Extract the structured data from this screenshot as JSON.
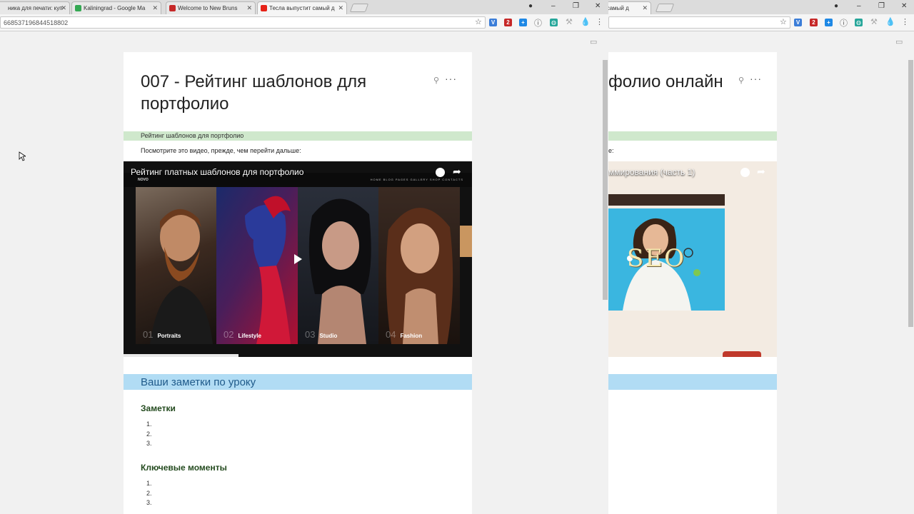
{
  "left": {
    "tabs": [
      {
        "title": "ника для печати: куп",
        "fav": "#e64a19"
      },
      {
        "title": "Kaliningrad - Google Ma",
        "fav": "#34a853"
      },
      {
        "title": "Welcome to New Bruns",
        "fav": "#c62828"
      },
      {
        "title": "Тесла выпустит самый д",
        "fav": "#e62117"
      }
    ],
    "url": "668537196844518802",
    "page_title": "007 - Рейтинг шаблонов для портфолио",
    "green_band": "Рейтинг шаблонов для портфолио",
    "hint": "Посмотрите это видео, прежде, чем перейти дальше:",
    "video": {
      "title": "Рейтинг платных шаблонов для портфолио",
      "nav_logo": "NOVO",
      "nav_links": "HOME  BLOG  PAGES  GALLERY  SHOP  CONTACTS",
      "panels": [
        {
          "num": "01",
          "label": "Portraits"
        },
        {
          "num": "02",
          "label": "Lifestyle"
        },
        {
          "num": "03",
          "label": "Studio"
        },
        {
          "num": "04",
          "label": "Fashion"
        }
      ],
      "progress": 0.33
    },
    "notes_band": "Ваши заметки по уроку",
    "notes_heading": "Заметки",
    "notes_items": [
      "1.",
      "2.",
      "3."
    ],
    "key_heading": "Ключевые моменты",
    "key_items": [
      "1.",
      "2.",
      "3."
    ]
  },
  "right": {
    "tabs": [
      {
        "title": "и самый д",
        "fav": "#e62117"
      }
    ],
    "page_title": "фолио онлайн",
    "hint": "е:",
    "video": {
      "title": "ммирования (часть 1)",
      "seo_word": "SEO"
    }
  },
  "colors": {
    "green_band": "#cfe8cc",
    "blue_band": "#b1dcf4",
    "heading_green": "#234a1e"
  }
}
